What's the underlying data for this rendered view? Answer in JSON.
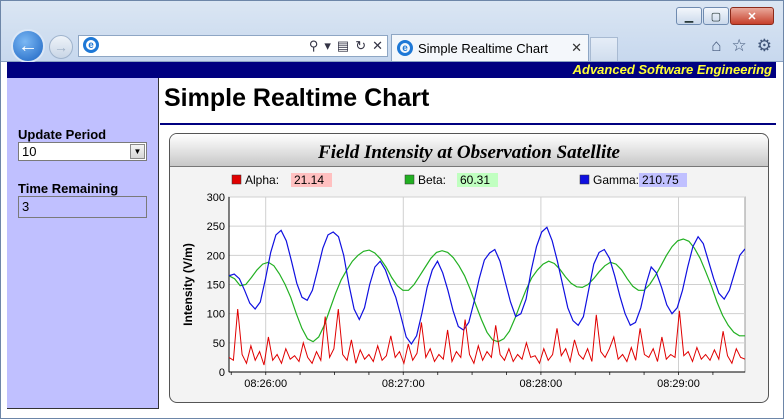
{
  "browser": {
    "tab_title": "Simple Realtime Chart",
    "address_value": "",
    "window_buttons": [
      "minimize-icon",
      "maximize-icon",
      "close-icon"
    ],
    "toolbar_icons": [
      "home-icon",
      "star-icon",
      "gear-icon"
    ]
  },
  "page": {
    "banner": "Advanced Software Engineering",
    "title": "Simple Realtime Chart"
  },
  "sidebar": {
    "update_period_label": "Update Period",
    "update_period_value": "10",
    "time_remaining_label": "Time Remaining",
    "time_remaining_value": "3"
  },
  "colors": {
    "banner_bg": "#000080",
    "banner_text": "#ffff33",
    "sidebar_bg": "#c0c0ff",
    "alpha": "#e00000",
    "beta": "#22b022",
    "gamma": "#1010e0"
  },
  "chart_data": {
    "type": "line",
    "title": "Field Intensity at Observation Satellite",
    "ylabel": "Intensity (V/m)",
    "xlabel": "",
    "ylim": [
      0,
      300
    ],
    "yticks": [
      "0",
      "50",
      "100",
      "150",
      "200",
      "250",
      "300"
    ],
    "x_range": [
      "08:25:44",
      "08:29:29"
    ],
    "xticks": [
      "08:26:00",
      "08:27:00",
      "08:28:00",
      "08:29:00"
    ],
    "grid": true,
    "legend": "top",
    "legend_values": [
      {
        "name": "Alpha",
        "value": "21.14",
        "color": "#e00000",
        "bg": "#ffc0c0"
      },
      {
        "name": "Beta",
        "value": "60.31",
        "color": "#22b022",
        "bg": "#c0ffc0"
      },
      {
        "name": "Gamma",
        "value": "210.75",
        "color": "#1010e0",
        "bg": "#c0c0ff"
      }
    ],
    "series": [
      {
        "name": "Alpha",
        "color": "#e00000",
        "values": [
          25,
          20,
          108,
          30,
          15,
          45,
          20,
          35,
          12,
          60,
          20,
          30,
          15,
          40,
          22,
          28,
          18,
          50,
          25,
          15,
          35,
          20,
          95,
          25,
          40,
          108,
          30,
          20,
          55,
          15,
          38,
          22,
          30,
          18,
          45,
          20,
          28,
          62,
          25,
          35,
          15,
          48,
          20,
          32,
          85,
          25,
          40,
          18,
          30,
          22,
          72,
          18,
          35,
          25,
          90,
          30,
          15,
          45,
          20,
          35,
          25,
          80,
          30,
          20,
          40,
          18,
          30,
          22,
          50,
          25,
          28,
          15,
          40,
          20,
          30,
          75,
          28,
          40,
          18,
          55,
          30,
          22,
          40,
          18,
          98,
          35,
          25,
          40,
          60,
          22,
          30,
          18,
          42,
          20,
          75,
          30,
          25,
          40,
          18,
          60,
          22,
          30,
          25,
          105,
          28,
          35,
          18,
          42,
          22,
          30,
          20,
          38,
          22,
          70,
          28,
          15,
          40,
          25,
          22
        ]
      },
      {
        "name": "Beta",
        "color": "#22b022",
        "values": [
          165,
          160,
          148,
          150,
          162,
          175,
          185,
          188,
          182,
          168,
          150,
          128,
          100,
          75,
          57,
          52,
          60,
          80,
          108,
          135,
          158,
          175,
          190,
          200,
          207,
          209,
          204,
          194,
          180,
          162,
          148,
          140,
          140,
          150,
          165,
          180,
          195,
          205,
          208,
          205,
          196,
          182,
          165,
          142,
          115,
          90,
          68,
          55,
          52,
          57,
          70,
          92,
          118,
          142,
          162,
          175,
          185,
          190,
          186,
          176,
          163,
          152,
          146,
          145,
          150,
          160,
          172,
          182,
          188,
          185,
          175,
          160,
          147,
          140,
          140,
          150,
          165,
          182,
          200,
          215,
          225,
          228,
          224,
          212,
          195,
          172,
          148,
          120,
          97,
          80,
          68,
          62,
          62
        ]
      },
      {
        "name": "Gamma",
        "color": "#1010e0",
        "values": [
          165,
          168,
          160,
          140,
          118,
          108,
          120,
          160,
          205,
          235,
          243,
          225,
          190,
          152,
          128,
          123,
          140,
          175,
          212,
          235,
          240,
          232,
          200,
          150,
          108,
          90,
          110,
          150,
          180,
          190,
          175,
          150,
          128,
          95,
          60,
          48,
          62,
          100,
          145,
          175,
          190,
          170,
          140,
          105,
          78,
          72,
          85,
          120,
          160,
          192,
          204,
          210,
          190,
          155,
          120,
          95,
          100,
          125,
          175,
          215,
          240,
          248,
          225,
          190,
          150,
          110,
          88,
          80,
          95,
          140,
          185,
          205,
          210,
          195,
          165,
          130,
          100,
          80,
          85,
          110,
          150,
          180,
          170,
          145,
          115,
          100,
          110,
          140,
          180,
          215,
          232,
          220,
          190,
          160,
          135,
          125,
          140,
          170,
          200,
          211
        ]
      }
    ]
  }
}
